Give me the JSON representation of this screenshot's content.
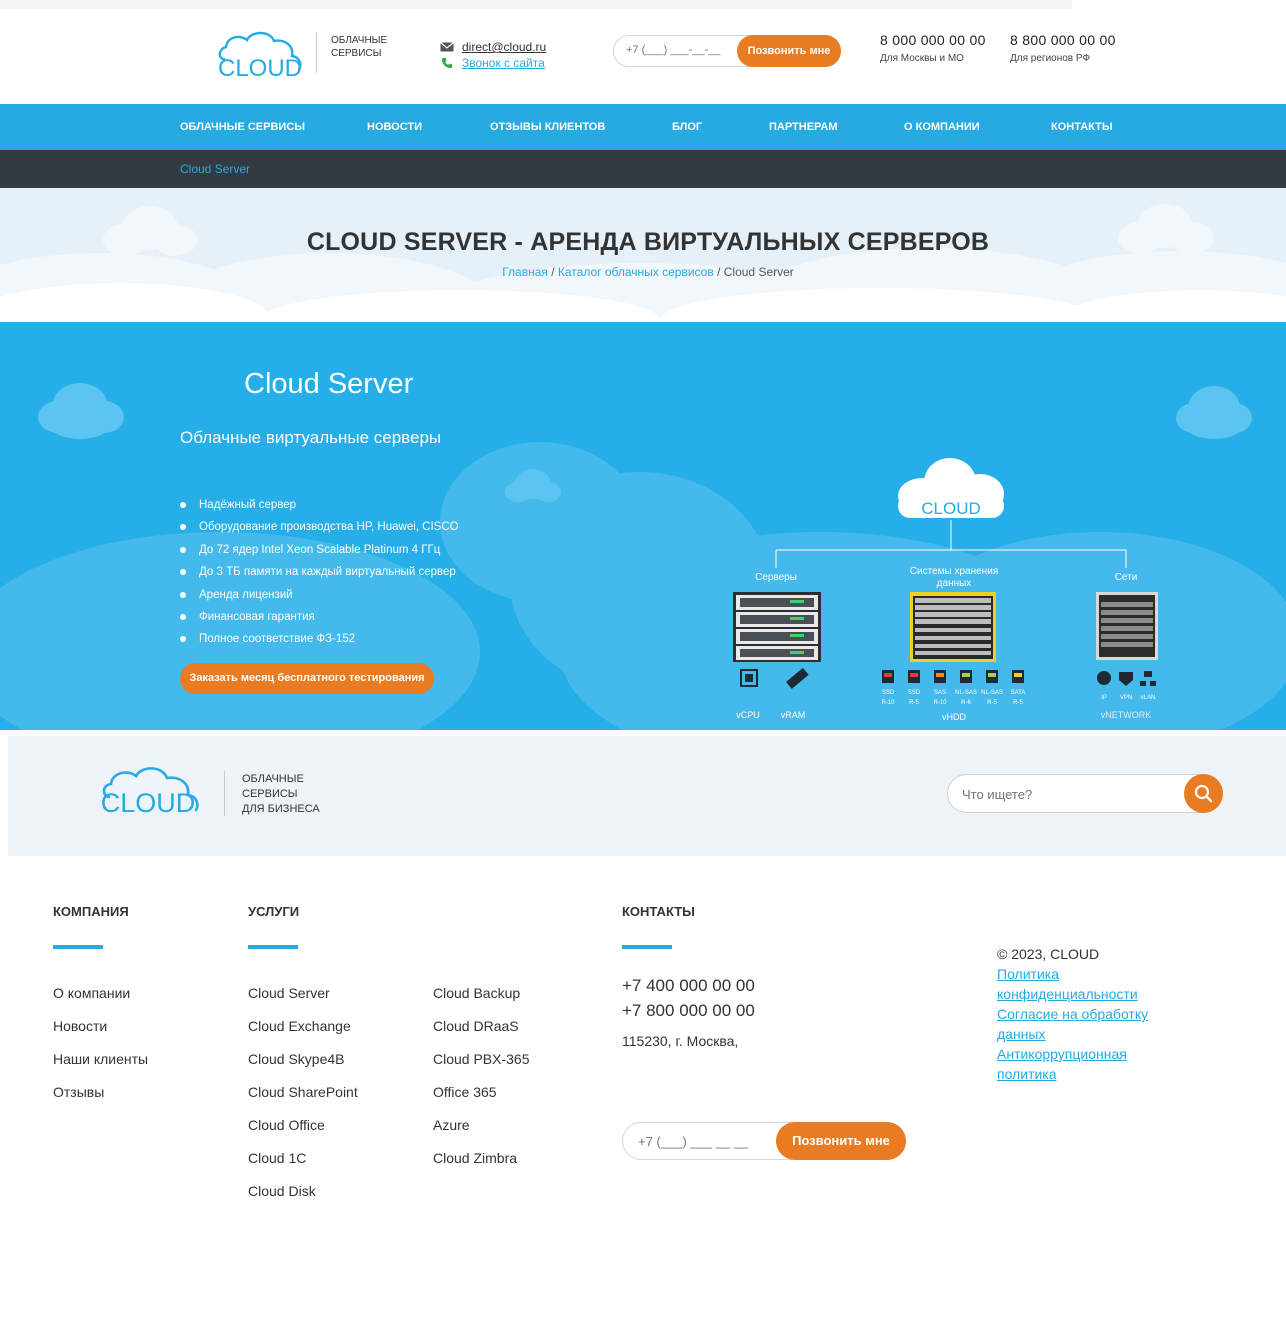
{
  "header": {
    "logo_text": "CLOUD",
    "tagline": "ОБЛАЧНЫЕ\nСЕРВИСЫ",
    "email": "direct@cloud.ru",
    "call_link": "Звонок с сайта",
    "phone_placeholder": "+7 (___) ___-__-__",
    "call_button": "Позвонить мне",
    "phones": [
      {
        "number": "8 000 000 00 00",
        "caption": "Для Москвы и МО"
      },
      {
        "number": "8 800 000 00 00",
        "caption": "Для регионов РФ"
      }
    ]
  },
  "nav": {
    "items": [
      "ОБЛАЧНЫЕ СЕРВИСЫ",
      "НОВОСТИ",
      "ОТЗЫВЫ КЛИЕНТОВ",
      "БЛОГ",
      "ПАРТНЕРАМ",
      "О КОМПАНИИ",
      "КОНТАКТЫ"
    ],
    "sub_item": "Cloud Server"
  },
  "page": {
    "title": "CLOUD SERVER - АРЕНДА ВИРТУАЛЬНЫХ СЕРВЕРОВ",
    "breadcrumbs": [
      "Главная",
      "Каталог облачных сервисов",
      "Cloud Server"
    ]
  },
  "hero": {
    "title": "Cloud Server",
    "subtitle": "Облачные виртуальные серверы",
    "features": [
      "Надёжный сервер",
      "Оборудование производства HP, Huawei, CISCO",
      "До 72 ядер Intel Xeon Scalable Platinum 4 ГГц",
      "До 3 ТБ памяти на каждый виртуальный сервер",
      "Аренда лицензий",
      "Финансовая гарантия",
      "Полное соответствие ФЗ-152"
    ],
    "cta": "Заказать месяц бесплатного тестирования",
    "diagram": {
      "cloud_label": "CLOUD",
      "servers": "Серверы",
      "storage": "Системы хранения\nданных",
      "networks": "Сети",
      "cpu": "vCPU",
      "ram": "vRAM",
      "hdd": "vHDD",
      "network": "vNETWORK",
      "disks": [
        {
          "top": "SSD",
          "bottom": "R-10",
          "color": "#e23a3a"
        },
        {
          "top": "SSD",
          "bottom": "R-5",
          "color": "#e23a3a"
        },
        {
          "top": "SAS",
          "bottom": "R-10",
          "color": "#f28a1e"
        },
        {
          "top": "NL-SAS",
          "bottom": "R-6",
          "color": "#a5d43a"
        },
        {
          "top": "NL-SAS",
          "bottom": "R-5",
          "color": "#a5d43a"
        },
        {
          "top": "SATA",
          "bottom": "R-5",
          "color": "#f5d020"
        }
      ],
      "net_icons": [
        "IP",
        "VPN",
        "vLAN"
      ]
    }
  },
  "footer": {
    "logo_text": "CLOUD",
    "tagline": "ОБЛАЧНЫЕ\nСЕРВИСЫ\nДЛЯ БИЗНЕСА",
    "search_placeholder": "Что ищете?",
    "company_heading": "КОМПАНИЯ",
    "company_links": [
      "О компании",
      "Новости",
      "Наши клиенты",
      "Отзывы"
    ],
    "services_heading": "УСЛУГИ",
    "services_col1": [
      "Cloud Server",
      "Cloud Exchange",
      "Cloud Skype4B",
      "Cloud SharePoint",
      "Cloud Office",
      "Cloud 1C",
      "Cloud Disk"
    ],
    "services_col2": [
      "Cloud Backup",
      "Cloud DRaaS",
      "Cloud PBX-365",
      "Office 365",
      "Azure",
      "Cloud Zimbra"
    ],
    "contacts_heading": "КОНТАКТЫ",
    "phones": [
      "+7 400 000 00 00",
      "+7 800 000 00 00"
    ],
    "address": "115230, г. Москва,",
    "phone_placeholder": "+7 (___) ___ __ __",
    "call_button": "Позвонить мне",
    "copyright": "© 2023, CLOUD",
    "legal_links": [
      "Политика конфиденциальности",
      "Согласие на обработку данных",
      "Антикоррупционная политика"
    ]
  },
  "colors": {
    "brand_blue": "#26aae2",
    "accent_orange": "#e97c23",
    "dark_bar": "#343a42"
  }
}
